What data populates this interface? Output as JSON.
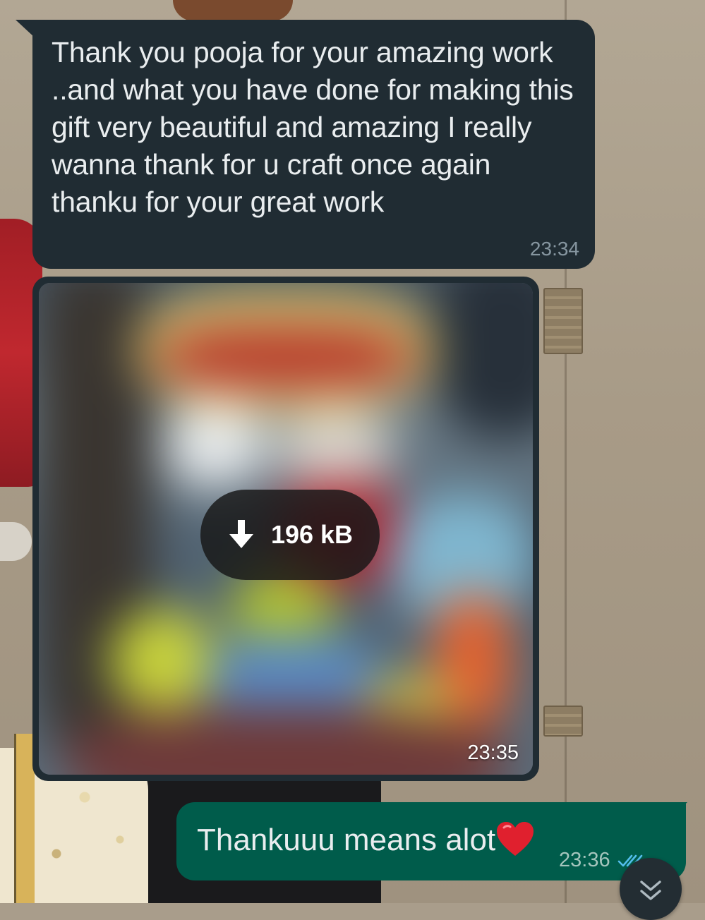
{
  "conversation": {
    "messages": [
      {
        "direction": "incoming",
        "type": "text",
        "text": "Thank you pooja for your amazing work ..and what you have done for making this gift very beautiful and amazing I really wanna thank for u craft once again thanku for your great work",
        "time": "23:34"
      },
      {
        "direction": "incoming",
        "type": "image",
        "download_size": "196 kB",
        "download_icon": "download-arrow-icon",
        "time": "23:35"
      },
      {
        "direction": "outgoing",
        "type": "text",
        "text": "Thankuuu means alot",
        "emoji": "red-heart-icon",
        "time": "23:36",
        "status_icon": "double-check-icon"
      }
    ]
  },
  "scroll_button": {
    "icon": "double-chevron-down-icon"
  },
  "colors": {
    "incoming_bubble": "#202c33",
    "outgoing_bubble": "#005c4b",
    "timestamp_incoming": "#8696a0",
    "timestamp_outgoing": "#a4c5bd",
    "read_ticks": "#53bdeb",
    "message_text": "#e9edef"
  }
}
